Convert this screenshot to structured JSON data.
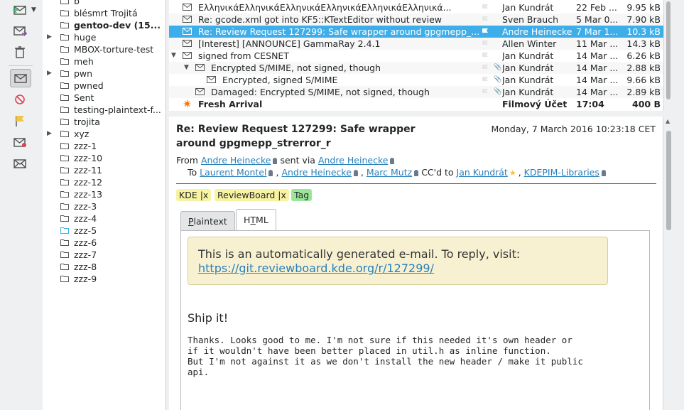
{
  "toolbar": {
    "buttons": [
      "inbox-check-icon",
      "compose-icon",
      "trash-icon",
      "mailbox-icon",
      "block-icon",
      "flag-icon",
      "mark-unread-icon",
      "mark-read-icon"
    ]
  },
  "tree": {
    "items": [
      {
        "label": "b",
        "arrow": false,
        "bold": false
      },
      {
        "label": "blésmrt Trojitá",
        "arrow": false,
        "bold": false
      },
      {
        "label": "gentoo-dev (15...",
        "arrow": false,
        "bold": true
      },
      {
        "label": "huge",
        "arrow": true,
        "bold": false
      },
      {
        "label": "MBOX-torture-test",
        "arrow": false,
        "bold": false
      },
      {
        "label": "meh",
        "arrow": false,
        "bold": false
      },
      {
        "label": "pwn",
        "arrow": true,
        "bold": false
      },
      {
        "label": "pwned",
        "arrow": false,
        "bold": false
      },
      {
        "label": "Sent",
        "arrow": false,
        "bold": false
      },
      {
        "label": "testing-plaintext-f...",
        "arrow": false,
        "bold": false
      },
      {
        "label": "trojita",
        "arrow": false,
        "bold": false
      },
      {
        "label": "xyz",
        "arrow": true,
        "bold": false
      },
      {
        "label": "zzz-1",
        "arrow": false,
        "bold": false
      },
      {
        "label": "zzz-10",
        "arrow": false,
        "bold": false
      },
      {
        "label": "zzz-11",
        "arrow": false,
        "bold": false
      },
      {
        "label": "zzz-12",
        "arrow": false,
        "bold": false
      },
      {
        "label": "zzz-13",
        "arrow": false,
        "bold": false
      },
      {
        "label": "zzz-3",
        "arrow": false,
        "bold": false
      },
      {
        "label": "zzz-4",
        "arrow": false,
        "bold": false
      },
      {
        "label": "zzz-5",
        "arrow": false,
        "bold": false,
        "blue": true
      },
      {
        "label": "zzz-6",
        "arrow": false,
        "bold": false
      },
      {
        "label": "zzz-7",
        "arrow": false,
        "bold": false
      },
      {
        "label": "zzz-8",
        "arrow": false,
        "bold": false
      },
      {
        "label": "zzz-9",
        "arrow": false,
        "bold": false
      }
    ]
  },
  "messages": [
    {
      "subject": "ΕλληνικάΕλληνικάΕλληνικάΕλληνικάΕλληνικάΕλληνικά...",
      "from": "Jan Kundrát",
      "date": "22 Feb ...",
      "size": "9.95 kB"
    },
    {
      "subject": "Re: gcode.xml got into KF5::KTextEditor without review",
      "from": "Sven Brauch",
      "date": "5 Mar 0...",
      "size": "7.90 kB"
    },
    {
      "subject": "Re: Review Request 127299: Safe wrapper around gpgmepp_...",
      "from": "Andre Heinecke",
      "date": "7 Mar 1...",
      "size": "10.3 kB",
      "selected": true
    },
    {
      "subject": "[Interest] [ANNOUNCE] GammaRay 2.4.1",
      "from": "Allen Winter",
      "date": "11 Mar ...",
      "size": "14.3 kB"
    },
    {
      "subject": "signed from CESNET",
      "from": "Jan Kundrát",
      "date": "14 Mar ...",
      "size": "6.26 kB",
      "expanded": true
    },
    {
      "subject": "Encrypted S/MIME, not signed, though",
      "from": "Jan Kundrát",
      "date": "14 Mar ...",
      "size": "2.88 kB",
      "expanded": true,
      "attachment": true
    },
    {
      "subject": "Encrypted, signed S/MIME",
      "from": "Jan Kundrát",
      "date": "14 Mar ...",
      "size": "9.66 kB",
      "attachment": true
    },
    {
      "subject": "Damaged: Encrypted S/MIME, not signed, though",
      "from": "Jan Kundrát",
      "date": "14 Mar ...",
      "size": "2.89 kB",
      "attachment": true
    },
    {
      "subject": "Fresh Arrival",
      "from": "Filmový Účet",
      "date": "17:04",
      "size": "400 B",
      "bold": true
    }
  ],
  "viewer": {
    "subject": "Re: Review Request 127299: Safe wrapper around gpgmepp_strerror_r",
    "date": "Monday, 7 March 2016 10:23:18 CET",
    "from_label": "From",
    "from": "Andre Heinecke",
    "sent_via_label": "sent via",
    "sent_via": "Andre Heinecke",
    "to_label": "To",
    "to": [
      "Laurent Montel",
      "Andre Heinecke",
      "Marc Mutz"
    ],
    "cc_label": "CC'd to",
    "cc": [
      "Jan Kundrát",
      "KDEPIM-Libraries"
    ],
    "tags": [
      {
        "label": "KDE |x",
        "color": "#f7f3a1"
      },
      {
        "label": "ReviewBoard |x",
        "color": "#f7f3a1"
      },
      {
        "label": "Tag",
        "color": "#9be59b"
      }
    ],
    "tabs": [
      "Plaintext",
      "HTML"
    ],
    "notice_text": "This is an automatically generated e-mail. To reply, visit:",
    "notice_link": "https://git.reviewboard.kde.org/r/127299/",
    "ship_it": "Ship it!",
    "body_lines": [
      "Thanks. Looks good to me. I'm not sure if this needed it's own header or",
      "if it wouldn't have been better placed in util.h as inline function.",
      "But I'm not against it as we don't install the new header / make it public",
      "api."
    ]
  }
}
